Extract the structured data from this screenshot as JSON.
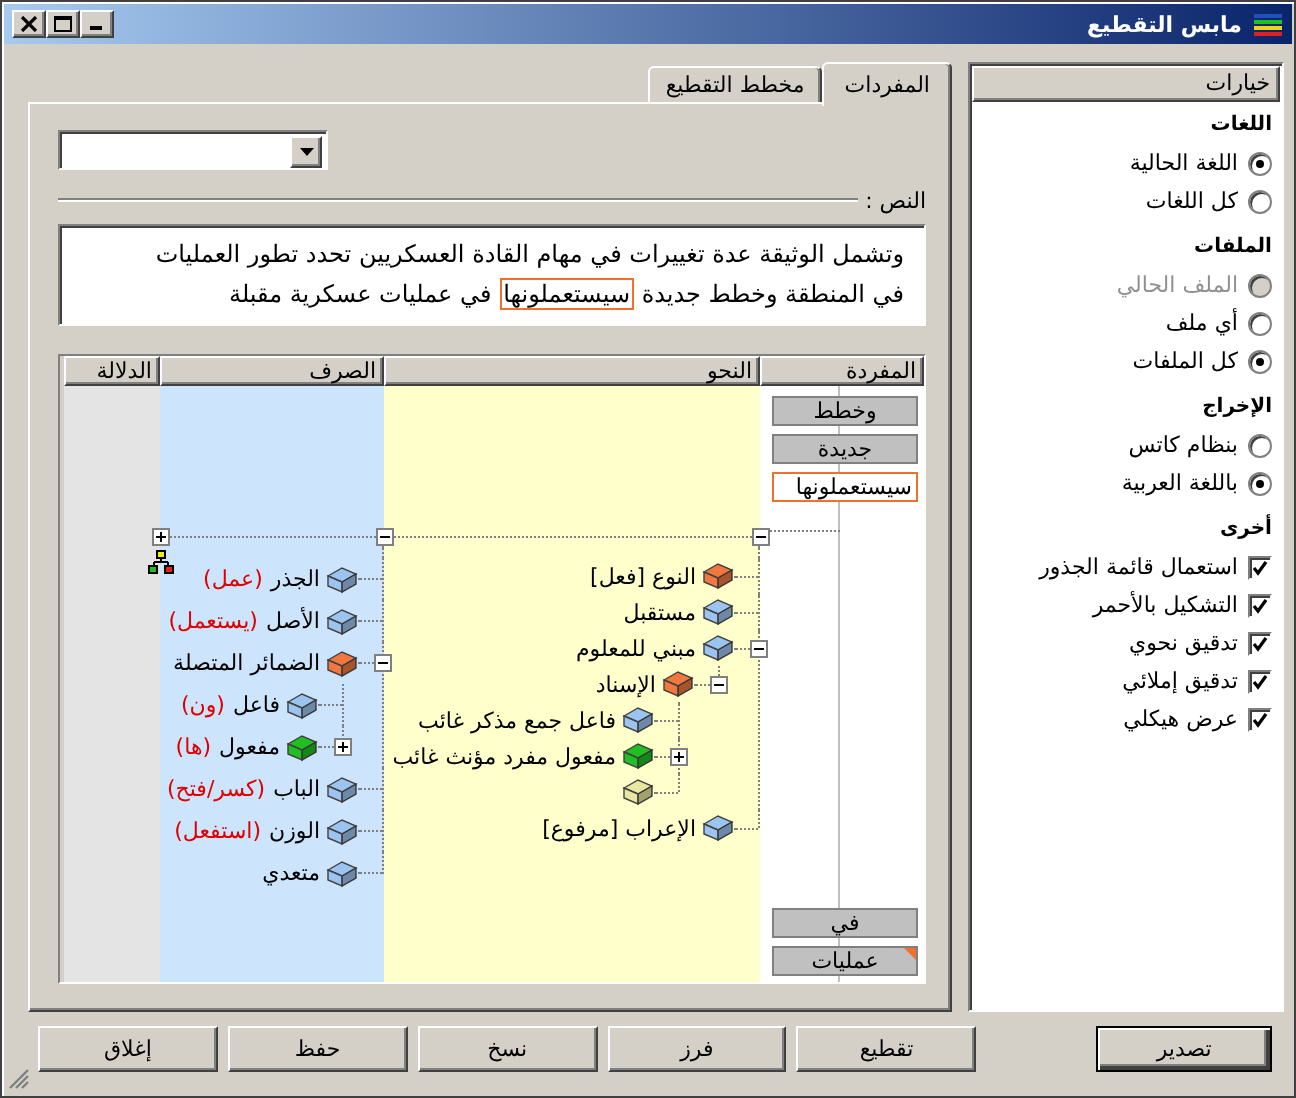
{
  "window": {
    "title": "مابس التقطيع"
  },
  "tabs": [
    {
      "label": "المفردات",
      "selected": true
    },
    {
      "label": "مخطط التقطيع",
      "selected": false
    }
  ],
  "text_label": "النص :",
  "text": [
    {
      "text": "وتشمل الوثيقة عدة تغييرات في مهام القادة العسكريين تحدد تطور العمليات في المنطقة وخطط جديدة ",
      "highlighted": false
    },
    {
      "text": "سيستعملونها",
      "highlighted": true
    },
    {
      "text": " في عمليات عسكرية مقبلة",
      "highlighted": false
    }
  ],
  "grid": {
    "columns": [
      "المفردة",
      "النحو",
      "الصرف",
      "الدلالة"
    ],
    "words_top": [
      {
        "label": "وخطط",
        "selected": false,
        "flagged": false
      },
      {
        "label": "جديدة",
        "selected": false,
        "flagged": false
      },
      {
        "label": "سيستعملونها",
        "selected": true,
        "flagged": false
      }
    ],
    "words_bottom": [
      {
        "label": "في",
        "selected": false,
        "flagged": false
      },
      {
        "label": "عمليات",
        "selected": false,
        "flagged": true
      }
    ],
    "syntax": {
      "expanded": true,
      "nodes": [
        {
          "label": "النوع [فعل]",
          "color": "#f07840"
        },
        {
          "label": "مستقبل",
          "color": "#9cc4f0"
        },
        {
          "label": "مبني للمعلوم",
          "color": "#9cc4f0",
          "expanded": true,
          "children": [
            {
              "label": "الإسناد",
              "color": "#f07840",
              "expanded": true,
              "children": [
                {
                  "label": "فاعل جمع مذكر غائب",
                  "color": "#9cc4f0"
                },
                {
                  "label": "مفعول مفرد مؤنث غائب",
                  "color": "#20c020",
                  "expanded": false
                },
                {
                  "color": "#e8e8a0"
                }
              ]
            }
          ]
        },
        {
          "label": "الإعراب [مرفوع]",
          "color": "#9cc4f0"
        }
      ]
    },
    "morphology": {
      "expanded": true,
      "nodes": [
        {
          "label": "الجذر",
          "value": "(عمل)",
          "color": "#9cc4f0"
        },
        {
          "label": "الأصل",
          "value": "(يستعمل)",
          "color": "#9cc4f0"
        },
        {
          "label": "الضمائر المتصلة",
          "color": "#f07840",
          "expanded": true,
          "children": [
            {
              "label": "فاعل",
              "value": "(ون)",
              "color": "#9cc4f0"
            },
            {
              "label": "مفعول",
              "value": "(ها)",
              "color": "#20c020",
              "expanded": false
            }
          ]
        },
        {
          "label": "الباب",
          "value": "(كسر/فتح)",
          "color": "#9cc4f0"
        },
        {
          "label": "الوزن",
          "value": "(استفعل)",
          "color": "#9cc4f0"
        },
        {
          "label": "متعدي",
          "color": "#9cc4f0"
        }
      ]
    },
    "semantics": {
      "expanded": false
    }
  },
  "options": {
    "title": "خيارات",
    "groups": [
      {
        "title": "اللغات",
        "items": [
          {
            "kind": "radio",
            "label": "اللغة الحالية",
            "checked": true,
            "disabled": false
          },
          {
            "kind": "radio",
            "label": "كل اللغات",
            "checked": false,
            "disabled": false
          }
        ]
      },
      {
        "title": "الملفات",
        "items": [
          {
            "kind": "radio",
            "label": "الملف الحالي",
            "checked": false,
            "disabled": true
          },
          {
            "kind": "radio",
            "label": "أي ملف",
            "checked": false,
            "disabled": false
          },
          {
            "kind": "radio",
            "label": "كل الملفات",
            "checked": true,
            "disabled": false
          }
        ]
      },
      {
        "title": "الإخراج",
        "items": [
          {
            "kind": "radio",
            "label": "بنظام كاتس",
            "checked": false,
            "disabled": false
          },
          {
            "kind": "radio",
            "label": "باللغة العربية",
            "checked": true,
            "disabled": false
          }
        ]
      },
      {
        "title": "أخرى",
        "items": [
          {
            "kind": "checkbox",
            "label": "استعمال قائمة الجذور",
            "checked": true,
            "disabled": false
          },
          {
            "kind": "checkbox",
            "label": "التشكيل بالأحمر",
            "checked": true,
            "disabled": false
          },
          {
            "kind": "checkbox",
            "label": "تدقيق نحوي",
            "checked": true,
            "disabled": false
          },
          {
            "kind": "checkbox",
            "label": "تدقيق إملائي",
            "checked": true,
            "disabled": false
          },
          {
            "kind": "checkbox",
            "label": "عرض هيكلي",
            "checked": true,
            "disabled": false
          }
        ]
      }
    ]
  },
  "buttons": [
    {
      "label": "تصدير",
      "default": true
    },
    {
      "label": "تقطيع",
      "default": false
    },
    {
      "label": "فرز",
      "default": false
    },
    {
      "label": "نسخ",
      "default": false
    },
    {
      "label": "حفظ",
      "default": false
    },
    {
      "label": "إغلاق",
      "default": false
    }
  ]
}
